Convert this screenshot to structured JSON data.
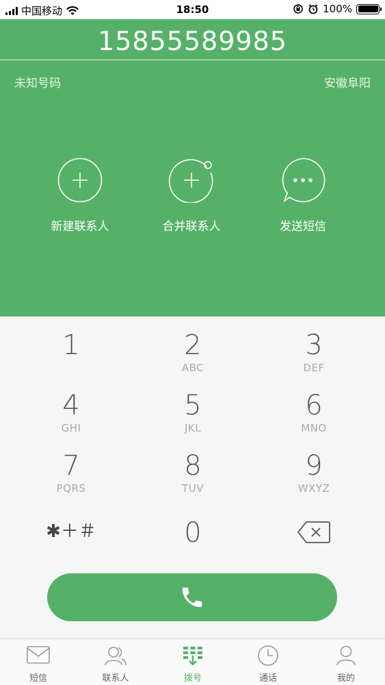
{
  "status_bar": {
    "carrier": "中国移动",
    "time": "18:50",
    "battery": "100%"
  },
  "header": {
    "phone_number": "15855589985",
    "number_type": "未知号码",
    "location": "安徽阜阳"
  },
  "actions": [
    {
      "label": "新建联系人",
      "icon": "add-contact-icon"
    },
    {
      "label": "合并联系人",
      "icon": "merge-contact-icon"
    },
    {
      "label": "发送短信",
      "icon": "send-sms-icon"
    }
  ],
  "keypad": {
    "keys": [
      {
        "digit": "1",
        "letters": ""
      },
      {
        "digit": "2",
        "letters": "ABC"
      },
      {
        "digit": "3",
        "letters": "DEF"
      },
      {
        "digit": "4",
        "letters": "GHI"
      },
      {
        "digit": "5",
        "letters": "JKL"
      },
      {
        "digit": "6",
        "letters": "MNO"
      },
      {
        "digit": "7",
        "letters": "PQRS"
      },
      {
        "digit": "8",
        "letters": "TUV"
      },
      {
        "digit": "9",
        "letters": "WXYZ"
      }
    ],
    "symbols": "✱＋＃",
    "zero": "0"
  },
  "tabs": [
    {
      "label": "短信",
      "icon": "message-icon",
      "active": false
    },
    {
      "label": "联系人",
      "icon": "contacts-icon",
      "active": false
    },
    {
      "label": "拨号",
      "icon": "dialpad-icon",
      "active": true
    },
    {
      "label": "通话",
      "icon": "clock-icon",
      "active": false
    },
    {
      "label": "我的",
      "icon": "profile-icon",
      "active": false
    }
  ],
  "colors": {
    "accent": "#56b168",
    "background": "#f6f6f6"
  }
}
